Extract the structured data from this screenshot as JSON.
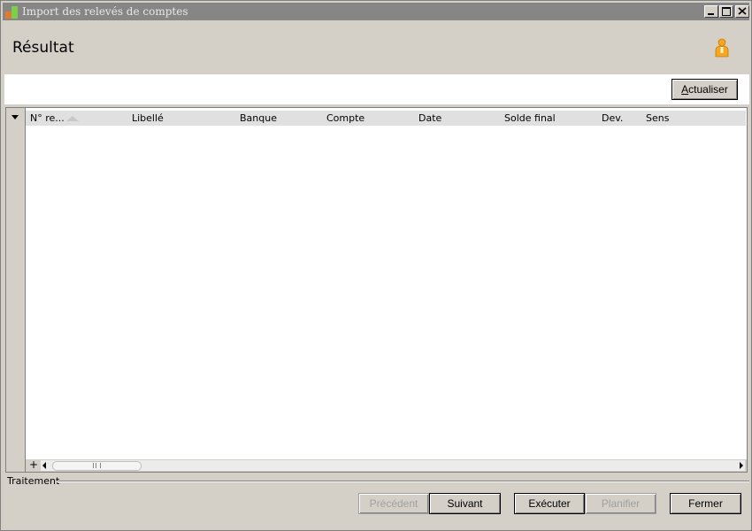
{
  "window": {
    "title": "Import des relevés de comptes"
  },
  "header": {
    "title": "Résultat",
    "user_icon": "user-icon"
  },
  "toolbar": {
    "refresh_label_accel": "A",
    "refresh_label_rest": "ctualiser"
  },
  "grid": {
    "columns": [
      {
        "label": "N° re...",
        "sorted": "ascending"
      },
      {
        "label": "Libellé"
      },
      {
        "label": "Banque"
      },
      {
        "label": "Compte"
      },
      {
        "label": "Date"
      },
      {
        "label": "Solde final"
      },
      {
        "label": "Dev."
      },
      {
        "label": "Sens"
      }
    ],
    "rows": [],
    "add_row_symbol": "+"
  },
  "footer": {
    "group_label": "Traitement",
    "buttons": {
      "previous": "Précédent",
      "next": "Suivant",
      "execute": "Exécuter",
      "schedule": "Planifier",
      "close": "Fermer"
    }
  }
}
